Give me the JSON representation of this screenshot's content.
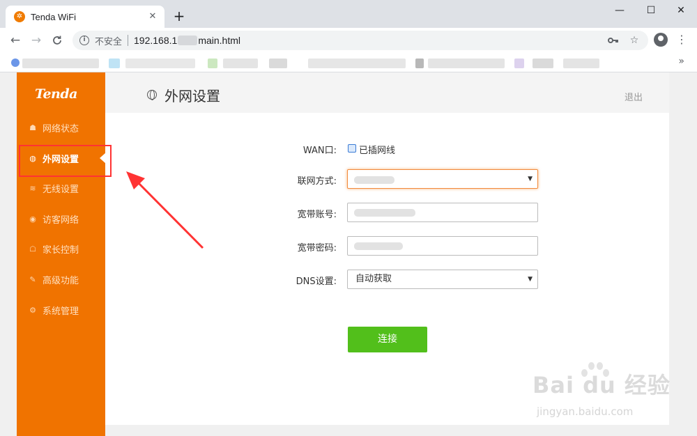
{
  "browser": {
    "tab_title": "Tenda WiFi",
    "tab_close": "✕",
    "new_tab": "+",
    "win_minimize": "—",
    "win_maximize": "☐",
    "win_close": "✕",
    "back": "←",
    "forward": "→",
    "reload": "C",
    "security_text": "不安全",
    "url_prefix": "192.168.1",
    "url_suffix": "main.html",
    "bookmarks_more": "»"
  },
  "sidebar": {
    "logo": "Tenda",
    "items": [
      {
        "label": "网络状态",
        "icon": "router-icon",
        "active": false
      },
      {
        "label": "外网设置",
        "icon": "globe-icon",
        "active": true
      },
      {
        "label": "无线设置",
        "icon": "wifi-icon",
        "active": false
      },
      {
        "label": "访客网络",
        "icon": "guest-icon",
        "active": false
      },
      {
        "label": "家长控制",
        "icon": "parental-icon",
        "active": false
      },
      {
        "label": "高级功能",
        "icon": "wrench-icon",
        "active": false
      },
      {
        "label": "系统管理",
        "icon": "settings-icon",
        "active": false
      }
    ]
  },
  "header": {
    "title": "外网设置",
    "logout": "退出"
  },
  "form": {
    "wan_label": "WAN口:",
    "wan_status": "已插网线",
    "connection_label": "联网方式:",
    "account_label": "宽带账号:",
    "password_label": "宽带密码:",
    "dns_label": "DNS设置:",
    "dns_value": "自动获取",
    "connect_button": "连接"
  },
  "watermark": {
    "main": "Bai du 经验",
    "sub": "jingyan.baidu.com"
  },
  "colors": {
    "sidebar": "#f07300",
    "connect": "#52bf1b",
    "annotation": "#ff3333"
  }
}
